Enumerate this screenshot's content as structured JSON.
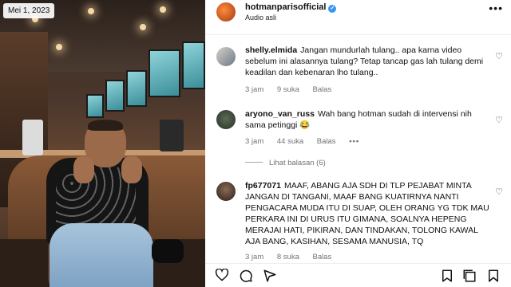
{
  "post": {
    "date_label": "Mei 1, 2023",
    "username": "hotmanparisofficial",
    "audio": "Audio asli",
    "more_label": "•••"
  },
  "comments": [
    {
      "username": "shelly.elmida",
      "text": "Jangan mundurlah tulang.. apa karna video sebelum ini alasannya tulang? Tetap tancap gas lah tulang demi keadilan dan kebenaran lho tulang..",
      "time": "3 jam",
      "likes": "9 suka",
      "reply_label": "Balas"
    },
    {
      "username": "aryono_van_russ",
      "text": "Wah bang hotman sudah di intervensi nih sama petinggi 😂",
      "time": "3 jam",
      "likes": "44 suka",
      "reply_label": "Balas",
      "more_label": "•••",
      "view_replies": "Lihat balasan (6)"
    },
    {
      "username": "fp677071",
      "text": "MAAF, ABANG AJA SDH DI TLP PEJABAT MINTA JANGAN DI TANGANI, MAAF BANG KUATIRNYA NANTI PENGACARA MUDA ITU DI SUAP, OLEH ORANG YG TDK MAU PERKARA INI DI URUS ITU GIMANA, SOALNYA HEPENG MERAJAI HATI, PIKIRAN, DAN TINDAKAN, TOLONG KAWAL AJA BANG, KASIHAN, SESAMA MANUSIA, TQ",
      "time": "3 jam",
      "likes": "8 suka",
      "reply_label": "Balas"
    }
  ],
  "icons": {
    "heart": "heart-icon",
    "comment": "comment-icon",
    "share": "send-icon",
    "save": "bookmark-icon",
    "repost": "repost-icon",
    "save_collection": "collection-icon"
  },
  "colors": {
    "verified": "#3897f0",
    "meta_text": "#737373"
  }
}
